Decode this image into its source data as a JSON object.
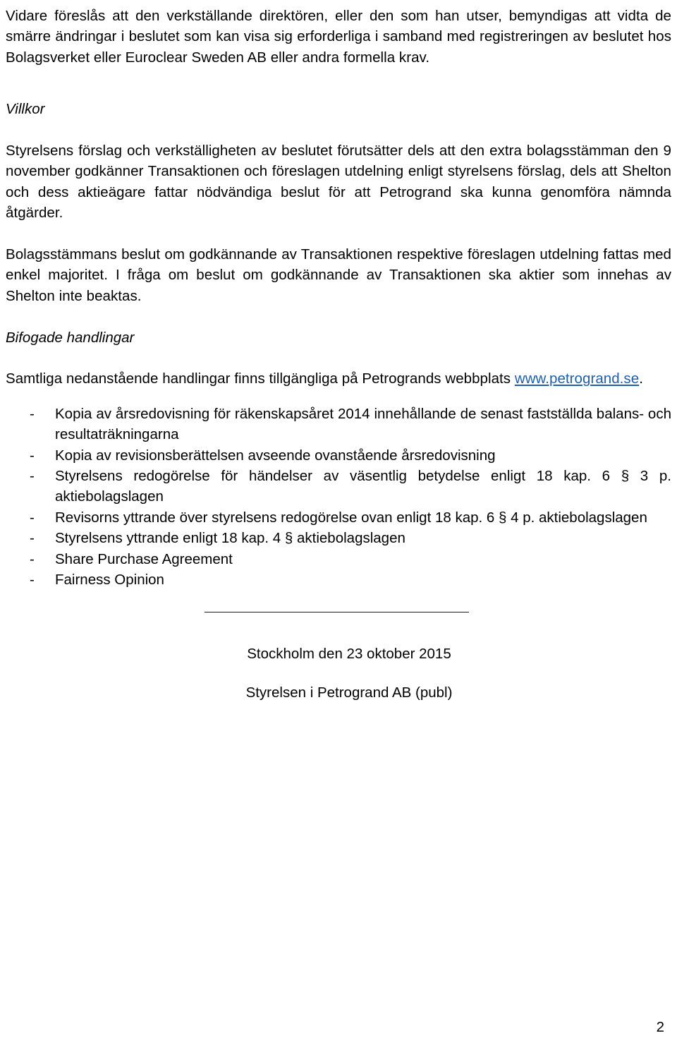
{
  "document": {
    "page_number": "2",
    "link_color": "#1f5fa8",
    "text_color": "#000000"
  },
  "intro_paragraph": "Vidare föreslås att den verkställande direktören, eller den som han utser, bemyndigas att vidta de smärre ändringar i beslutet som kan visa sig erforderliga i samband med registreringen av beslutet hos Bolagsverket eller Euroclear Sweden AB eller andra formella krav.",
  "sections": [
    {
      "heading": "Villkor",
      "paragraphs": [
        "Styrelsens förslag och verkställigheten av beslutet förutsätter dels att den extra bolagsstämman den 9 november godkänner Transaktionen och föreslagen utdelning enligt styrelsens förslag, dels att Shelton och dess aktieägare fattar nödvändiga beslut för att Petrogrand ska kunna genomföra nämnda åtgärder.",
        "Bolagsstämmans beslut om godkännande av Transaktionen respektive föreslagen utdelning fattas med enkel majoritet. I fråga om beslut om godkännande av Transaktionen ska aktier som innehas av Shelton inte beaktas."
      ]
    },
    {
      "heading": "Bifogade handlingar",
      "intro_prefix": "Samtliga nedanstående handlingar finns tillgängliga på Petrogrands webbplats ",
      "link_text": "www.petrogrand.se",
      "intro_suffix": ".",
      "list_marker": "-",
      "attachments": [
        "Kopia av årsredovisning för räkenskapsåret 2014 innehållande de senast fastställda balans- och resultaträkningarna",
        "Kopia av revisionsberättelsen avseende ovanstående årsredovisning",
        "Styrelsens redogörelse för händelser av väsentlig betydelse enligt 18 kap. 6 § 3 p. aktiebolagslagen",
        "Revisorns yttrande över styrelsens redogörelse ovan enligt 18 kap. 6 § 4 p. aktiebolagslagen",
        "Styrelsens yttrande enligt 18 kap. 4 § aktiebolagslagen",
        "Share Purchase Agreement",
        "Fairness Opinion"
      ]
    }
  ],
  "signature": {
    "place_and_date": "Stockholm den 23 oktober 2015",
    "signatory": "Styrelsen i Petrogrand AB (publ)"
  }
}
